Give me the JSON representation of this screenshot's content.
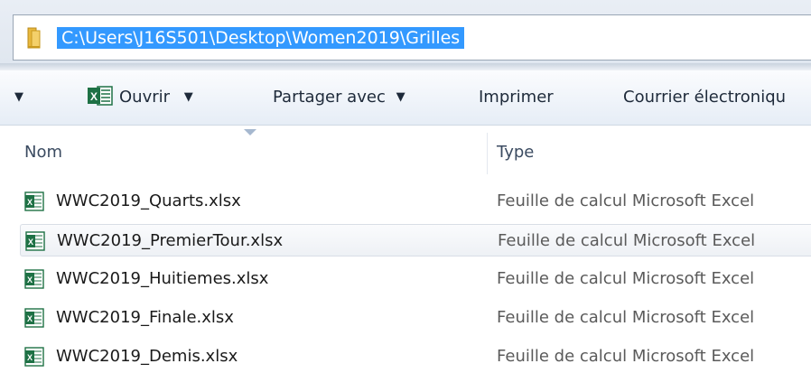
{
  "address_bar": {
    "path": "C:\\Users\\J16S501\\Desktop\\Women2019\\Grilles"
  },
  "toolbar": {
    "open_label": "Ouvrir",
    "share_label": "Partager avec",
    "print_label": "Imprimer",
    "email_label": "Courrier électroniqu"
  },
  "columns": {
    "name": "Nom",
    "type": "Type"
  },
  "files": [
    {
      "name": "WWC2019_Quarts.xlsx",
      "type": "Feuille de calcul Microsoft Excel"
    },
    {
      "name": "WWC2019_PremierTour.xlsx",
      "type": "Feuille de calcul Microsoft Excel"
    },
    {
      "name": "WWC2019_Huitiemes.xlsx",
      "type": "Feuille de calcul Microsoft Excel"
    },
    {
      "name": "WWC2019_Finale.xlsx",
      "type": "Feuille de calcul Microsoft Excel"
    },
    {
      "name": "WWC2019_Demis.xlsx",
      "type": "Feuille de calcul Microsoft Excel"
    }
  ],
  "icons": {
    "folder": "folder-icon",
    "excel": "excel-icon",
    "file": "excel-file-icon"
  },
  "colors": {
    "selection": "#3399ff",
    "excel_green": "#1e7145"
  }
}
